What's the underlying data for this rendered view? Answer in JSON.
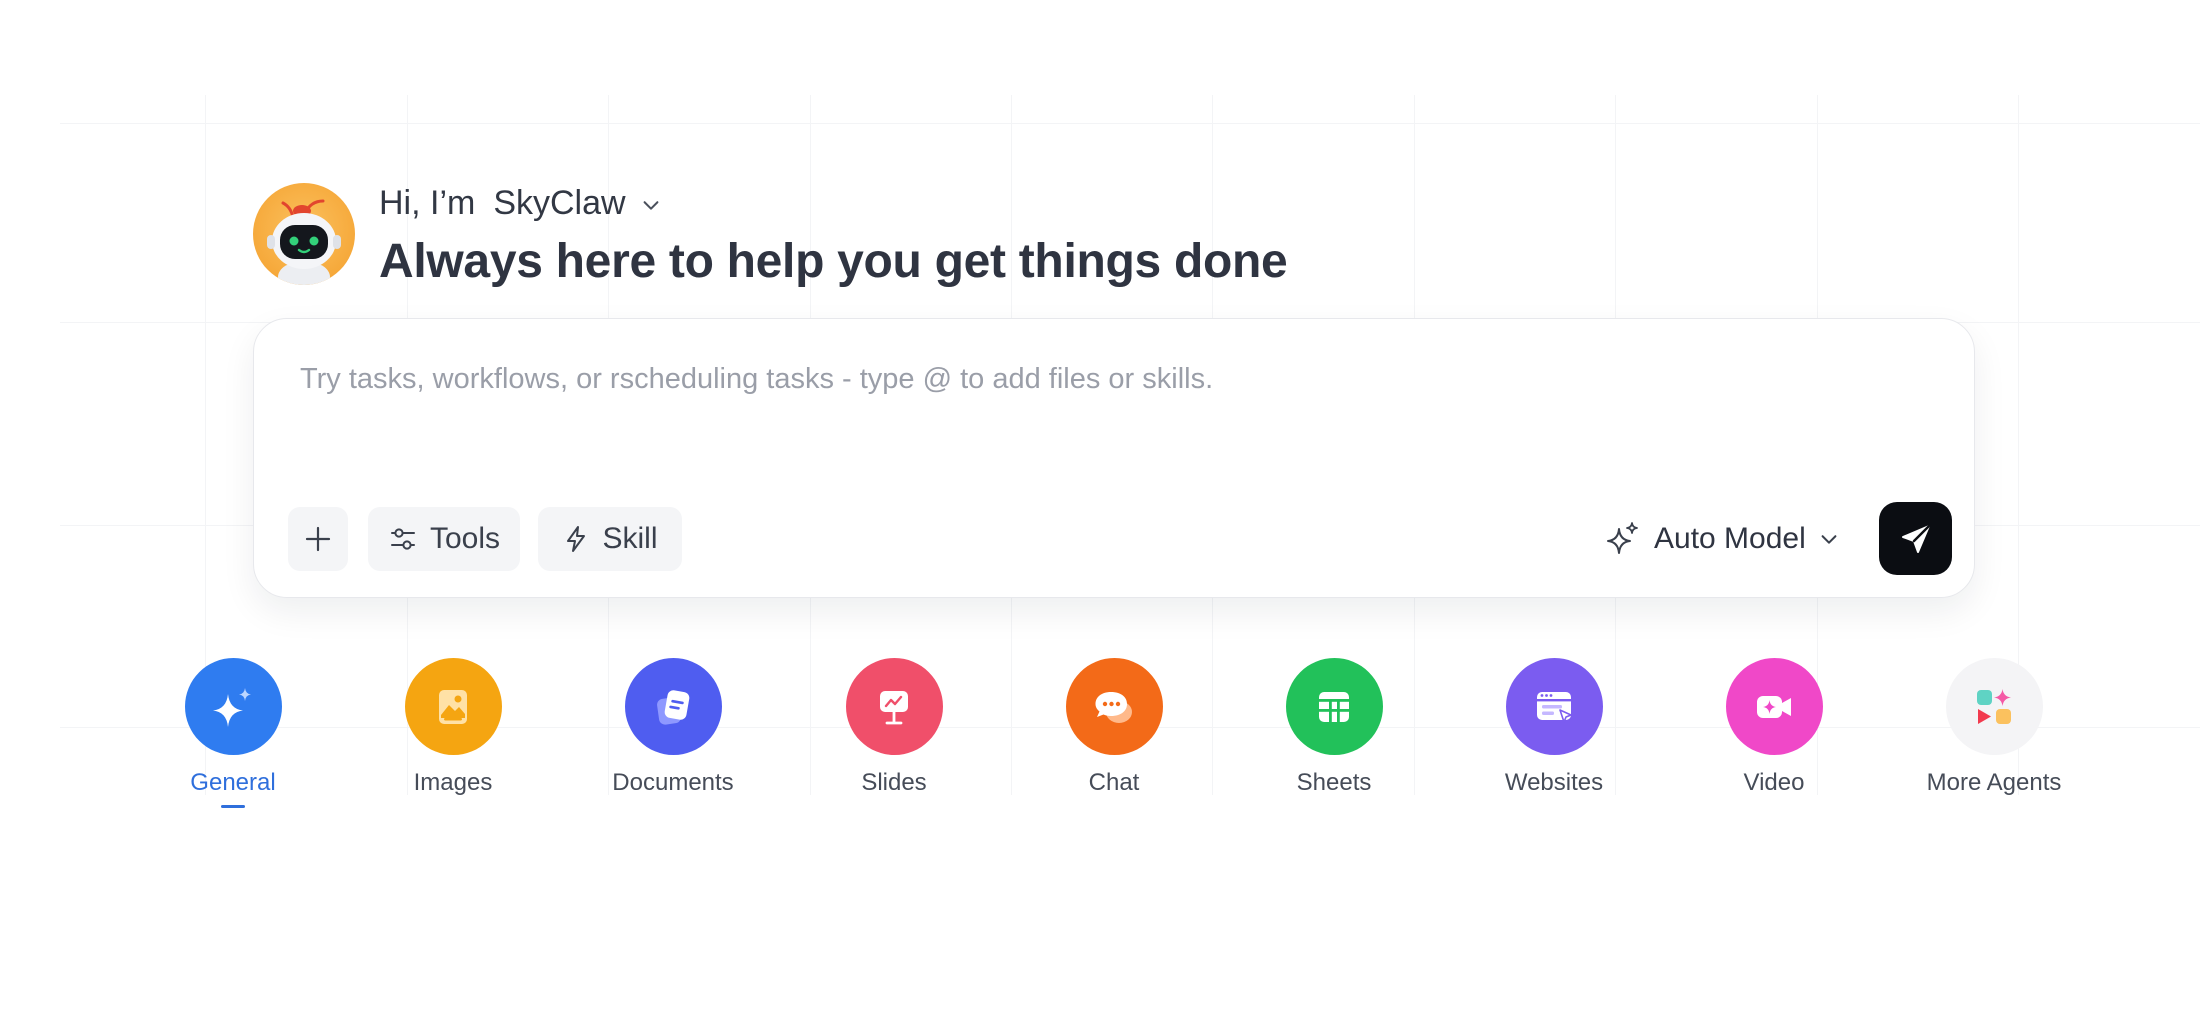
{
  "header": {
    "greeting": "Hi, I’m",
    "assistant_name": "SkyClaw",
    "tagline": "Always here to help you get things done"
  },
  "composer": {
    "placeholder": "Try tasks, workflows, or rscheduling tasks - type @ to add files or skills.",
    "value": "",
    "tools_label": "Tools",
    "skill_label": "Skill",
    "model_label": "Auto Model"
  },
  "agents": [
    {
      "label": "General",
      "icon": "sparkle-icon",
      "color": "#2f7cf0",
      "active": true
    },
    {
      "label": "Images",
      "icon": "image-icon",
      "color": "#f5a511",
      "active": false
    },
    {
      "label": "Documents",
      "icon": "document-icon",
      "color": "#4f5df0",
      "active": false
    },
    {
      "label": "Slides",
      "icon": "presentation-icon",
      "color": "#f04f6a",
      "active": false
    },
    {
      "label": "Chat",
      "icon": "chat-bubble-icon",
      "color": "#f36a18",
      "active": false
    },
    {
      "label": "Sheets",
      "icon": "table-icon",
      "color": "#22c15a",
      "active": false
    },
    {
      "label": "Websites",
      "icon": "browser-icon",
      "color": "#7b5cf0",
      "active": false
    },
    {
      "label": "Video",
      "icon": "video-camera-icon",
      "color": "#f048c8",
      "active": false
    },
    {
      "label": "More Agents",
      "icon": "apps-grid-icon",
      "color": "#f4f4f6",
      "active": false
    }
  ],
  "colors": {
    "accent": "#2f6fdc",
    "send_button": "#0b0d12"
  }
}
